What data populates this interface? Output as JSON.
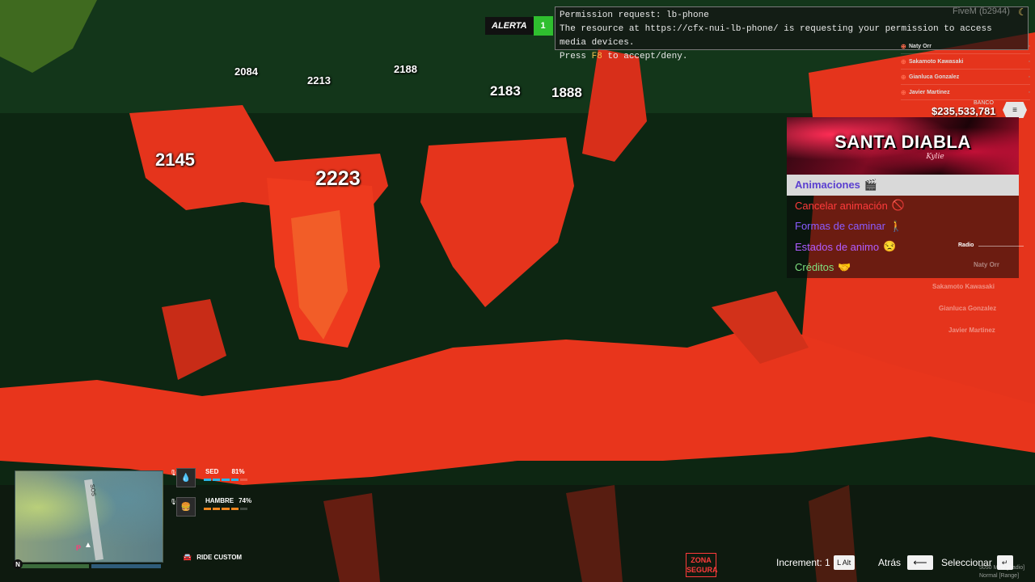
{
  "player_ids": [
    "2084",
    "2213",
    "2188",
    "2183",
    "1888",
    "2145",
    "2223"
  ],
  "alert": {
    "label": "ALERTA",
    "count": "1"
  },
  "permission": {
    "line1": "Permission request: lb-phone",
    "line2": "The resource at https://cfx-nui-lb-phone/ is requesting your permission to access media devices.",
    "line3_prefix": "Press ",
    "line3_key": "F8",
    "line3_suffix": " to accept/deny."
  },
  "header": {
    "server": "FiveM (b2944)",
    "icon": "moon-icon"
  },
  "player_list": [
    "Naty Orr",
    "Sakamoto Kawasaki",
    "Gianluca Gonzalez",
    "Javier Martinez"
  ],
  "bank": {
    "label": "BANCO",
    "amount": "$235,533,781"
  },
  "menu": {
    "title": "SANTA DIABLA",
    "signature": "Kylie",
    "items": [
      {
        "label": "Animaciones",
        "emoji": "🎬",
        "color": "#5a3fd0"
      },
      {
        "label": "Cancelar animación",
        "emoji": "🚫",
        "color": "#ff3b3b"
      },
      {
        "label": "Formas de caminar",
        "emoji": "🚶",
        "color": "#8a5cff"
      },
      {
        "label": "Estados de animo",
        "emoji": "😒",
        "color": "#b05cff"
      },
      {
        "label": "Créditos",
        "emoji": "🤝",
        "color": "#7fe07f"
      }
    ]
  },
  "radio": {
    "label": "Radio",
    "members": [
      "Naty Orr",
      "Sakamoto Kawasaki",
      "Gianluca Gonzalez",
      "Javier Martinez"
    ]
  },
  "status": {
    "thirst": {
      "label": "SED",
      "value": "81%",
      "fraction": 0.81,
      "color": "#2bb6e8"
    },
    "hunger": {
      "label": "HAMBRE",
      "value": "74%",
      "fraction": 0.74,
      "color": "#f0861e"
    }
  },
  "minimap": {
    "north": "N",
    "street": "SOS"
  },
  "vehicle": {
    "name": "RIDE CUSTOM"
  },
  "zone": {
    "line1": "ZONA",
    "line2": "SEGURA"
  },
  "controls": {
    "increment_label": "Increment: 1",
    "increment_key": "L Alt",
    "back_label": "Atrás",
    "select_label": "Seleccionar"
  },
  "radio_info": {
    "line1": "5050 MHz [Radio]",
    "line2": "Normal [Range]"
  }
}
